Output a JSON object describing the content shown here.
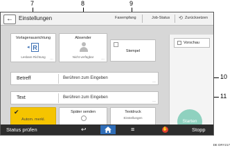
{
  "callouts": {
    "c7": "7",
    "c8": "8",
    "c9": "9",
    "c10": "10",
    "c11": "11"
  },
  "titlebar": {
    "back_icon": "arrow-left-icon",
    "title": "Einstellungen",
    "faxempfang": "Faxempfang",
    "job_status": "Job-Status",
    "reset": "Zurücksetzen"
  },
  "cards": {
    "vorlage": {
      "label": "Vorlagenausrichtung",
      "sub": "Lesbare Richtung"
    },
    "absender": {
      "label": "Absender",
      "sub": "Nicht verfügbar"
    },
    "stempel": {
      "label": "Stempel"
    }
  },
  "rows": {
    "betreff": {
      "label": "Betreff",
      "value": "Berühren zum Eingeben"
    },
    "text": {
      "label": "Text",
      "value": "Berühren zum Eingeben"
    }
  },
  "bottom_cards": {
    "autom": {
      "label": "Autom. merkl."
    },
    "spaeter": {
      "label": "Später senden"
    },
    "textdruck": {
      "label": "Textdruck",
      "sub": "Einstellungen"
    }
  },
  "side": {
    "preview_label": "Vorschau",
    "start": "Starten"
  },
  "bottombar": {
    "status": "Status prüfen",
    "stop": "Stopp"
  },
  "footer_code": "DE DRY217",
  "colors": {
    "accent_yellow": "#f5c400",
    "start_green": "#8fd1bf",
    "home_blue": "#2f6db8",
    "stop_red": "#e0412f"
  }
}
